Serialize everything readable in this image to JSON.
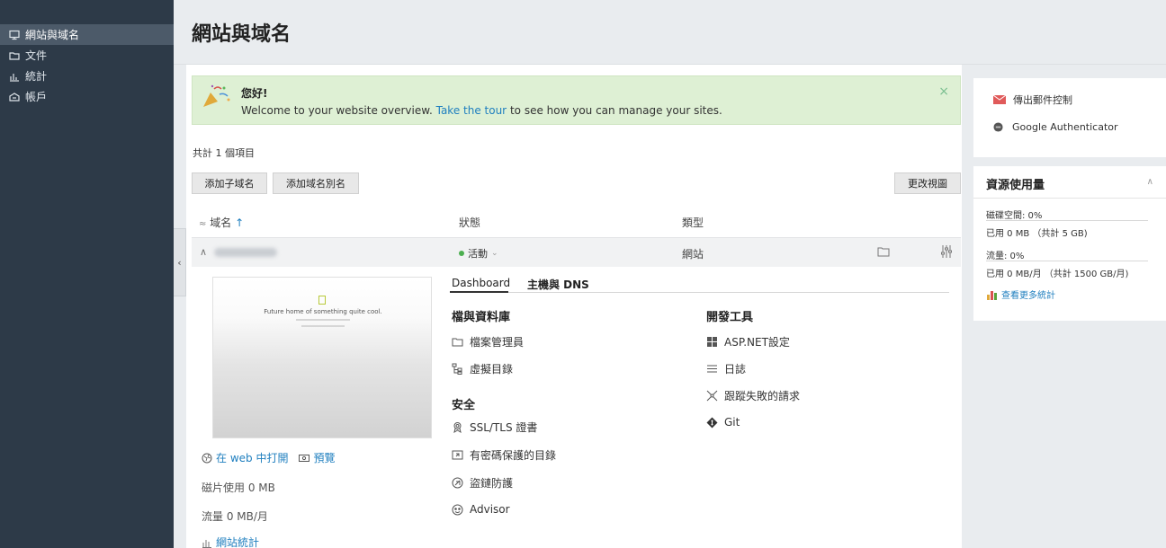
{
  "sidebar": {
    "items": [
      {
        "label": "網站與域名",
        "icon": "monitor-icon"
      },
      {
        "label": "文件",
        "icon": "folder-icon"
      },
      {
        "label": "統計",
        "icon": "bar-chart-icon"
      },
      {
        "label": "帳戶",
        "icon": "account-icon"
      }
    ]
  },
  "header": {
    "title": "網站與域名"
  },
  "banner": {
    "title": "您好!",
    "text_before": "Welcome to your website overview.",
    "link": "Take the tour",
    "text_after": "to see how you can manage your sites.",
    "close": "×"
  },
  "list": {
    "total": "共計 1 個項目",
    "buttons": {
      "add_subdomain": "添加子域名",
      "add_alias": "添加域名別名",
      "change_view": "更改視圖"
    },
    "columns": {
      "sort_icon": "≈",
      "domain": "域名",
      "sort_arrow": "↑",
      "status": "狀態",
      "type": "類型"
    }
  },
  "domain": {
    "status": "活動",
    "status_caret": "⌄",
    "type": "網站",
    "preview": {
      "title": "Future home of something quite cool."
    },
    "open_in_web": "在 web 中打開",
    "preview_link": "預覽",
    "disk_usage": "磁片使用 0 MB",
    "traffic": "流量 0 MB/月",
    "site_stats": "網站統計"
  },
  "tabs": [
    {
      "label": "Dashboard",
      "active": true
    },
    {
      "label": "主機與 DNS",
      "active": false
    }
  ],
  "tools": {
    "files_title": "檔與資料庫",
    "file_manager": "檔案管理員",
    "virtual_dirs": "虛擬目錄",
    "security_title": "安全",
    "ssl": "SSL/TLS 證書",
    "password_dirs": "有密碼保護的目錄",
    "hotlink": "盜鏈防護",
    "advisor": "Advisor",
    "dev_title": "開發工具",
    "aspnet": "ASP.NET設定",
    "logs": "日誌",
    "failed_requests": "跟蹤失敗的請求",
    "git": "Git"
  },
  "right": {
    "mail_control": "傳出郵件控制",
    "google_auth": "Google Authenticator",
    "resource_title": "資源使用量",
    "disk_label": "磁碟空間: 0%",
    "disk_used": "已用 0 MB （共計 5 GB)",
    "disk_fraction": 0,
    "traffic_label": "流量: 0%",
    "traffic_used": "已用 0 MB/月 （共計 1500 GB/月)",
    "traffic_fraction": 0,
    "more_stats": "查看更多統計"
  },
  "colors": {
    "accent": "#1f7fbf",
    "sidebar": "#2d3a48",
    "banner": "#def0d4",
    "status_ok": "#4caf50"
  }
}
